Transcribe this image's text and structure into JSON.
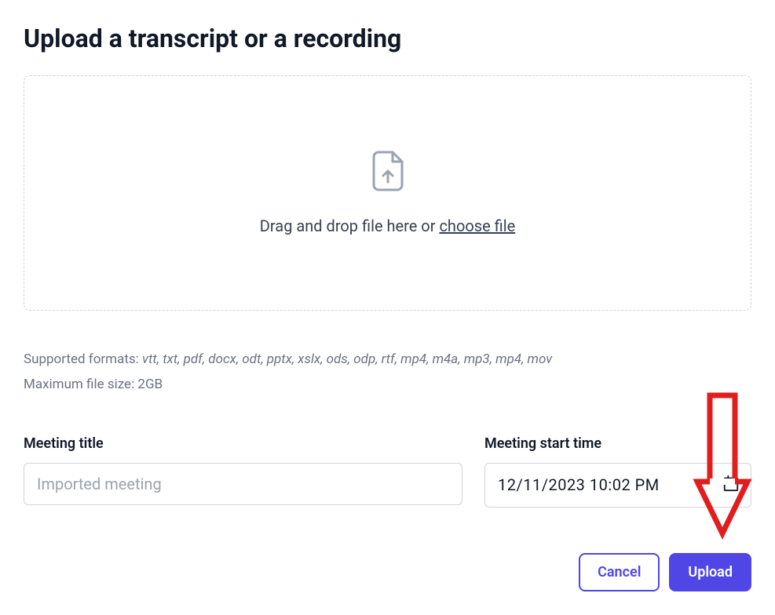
{
  "title": "Upload a transcript or a recording",
  "dropzone": {
    "prefix": "Drag and drop file here or ",
    "choose_link": "choose file"
  },
  "info": {
    "formats_label": "Supported formats: ",
    "formats_list": "vtt, txt, pdf, docx, odt, pptx, xslx, ods, odp, rtf, mp4, m4a, mp3, mp4, mov",
    "max_size_label": "Maximum file size: ",
    "max_size_value": "2GB"
  },
  "fields": {
    "title": {
      "label": "Meeting title",
      "placeholder": "Imported meeting",
      "value": ""
    },
    "start_time": {
      "label": "Meeting start time",
      "value": "12/11/2023 10:02 PM"
    }
  },
  "buttons": {
    "cancel": "Cancel",
    "upload": "Upload"
  }
}
